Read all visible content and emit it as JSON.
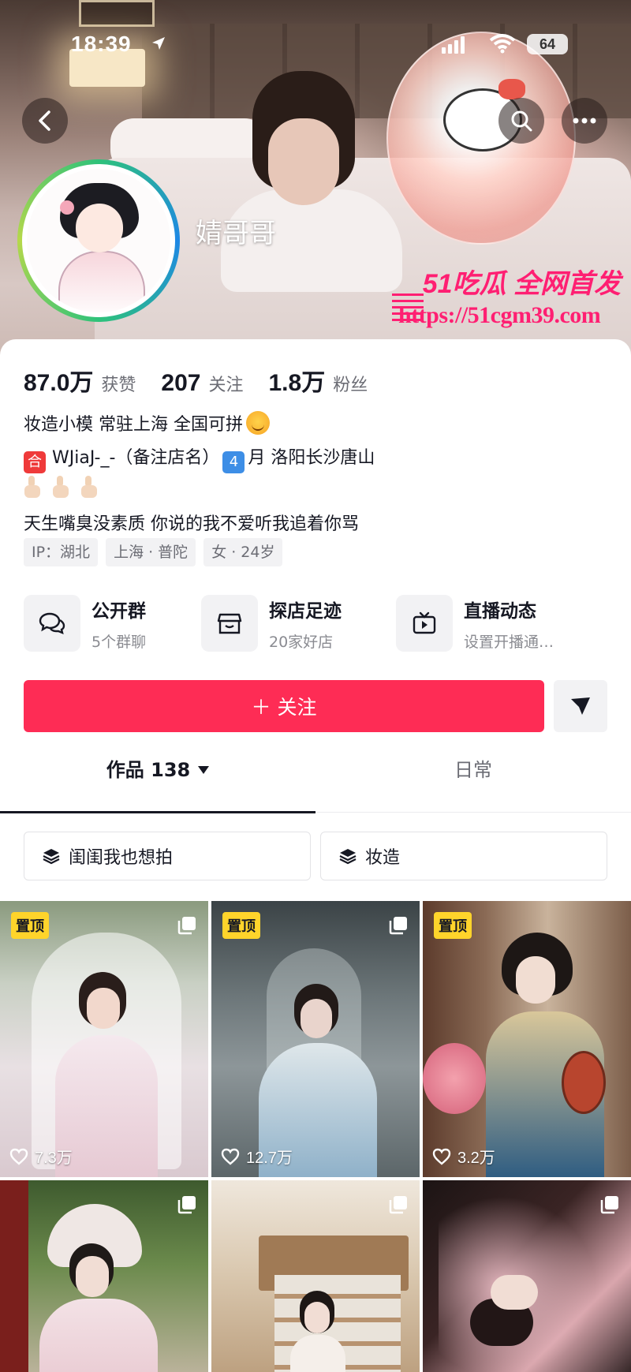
{
  "status_bar": {
    "time": "18:39",
    "battery": "64"
  },
  "header": {
    "nickname": "婧哥哥"
  },
  "watermark": {
    "line1": "51吃瓜 全网首发",
    "line2": "https://51cgm39.com"
  },
  "stats": [
    {
      "value": "87.0万",
      "label": "获赞"
    },
    {
      "value": "207",
      "label": "关注"
    },
    {
      "value": "1.8万",
      "label": "粉丝"
    }
  ],
  "bio": {
    "line1": "妆造小模 常驻上海 全国可拼",
    "line2_badge": "合",
    "line2_a": "WJiaJ-_-（备注店名）",
    "line2_num": "4",
    "line2_b": "月 洛阳长沙唐山",
    "line4": "天生嘴臭没素质 你说的我不爱听我追着你骂"
  },
  "tags": [
    "IP：湖北",
    "上海 · 普陀",
    "女 · 24岁"
  ],
  "features": [
    {
      "title": "公开群",
      "sub": "5个群聊",
      "icon": "chat-bubbles-icon"
    },
    {
      "title": "探店足迹",
      "sub": "20家好店",
      "icon": "store-icon"
    },
    {
      "title": "直播动态",
      "sub": "设置开播通…",
      "icon": "tv-icon"
    }
  ],
  "actions": {
    "follow": "＋ 关注"
  },
  "tabs": {
    "works": "作品 138",
    "daily": "日常"
  },
  "collections": [
    "闺闺我也想拍",
    "妆造"
  ],
  "posts": [
    {
      "pinned": "置顶",
      "likes": "7.3万"
    },
    {
      "pinned": "置顶",
      "likes": "12.7万"
    },
    {
      "pinned": "置顶",
      "likes": "3.2万"
    },
    {
      "pinned": "",
      "likes": ""
    },
    {
      "pinned": "",
      "likes": ""
    },
    {
      "pinned": "",
      "likes": ""
    }
  ],
  "colors": {
    "accent": "#fe2c55",
    "pin": "#ffd42b",
    "watermark": "#ff1f72"
  }
}
